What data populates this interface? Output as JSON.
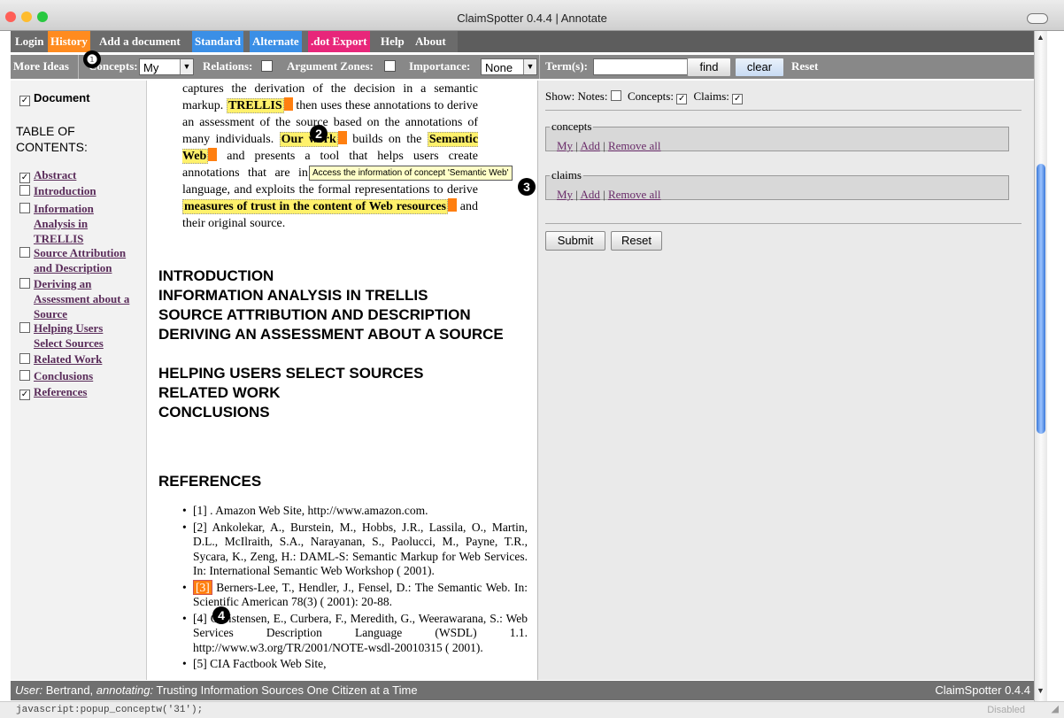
{
  "window": {
    "title": "ClaimSpotter 0.4.4 | Annotate",
    "lights": {
      "close": "#ff5f57",
      "minimize": "#febc2e",
      "zoom": "#28c840"
    }
  },
  "menu": [
    {
      "label": "Login",
      "bg": ""
    },
    {
      "label": "History",
      "bg": "#ff8b1f"
    },
    {
      "label": "Add a document",
      "bg": ""
    },
    {
      "label": "Standard",
      "bg": "#3b8fe6"
    },
    {
      "label": "Alternate",
      "bg": "#3b8fe6"
    },
    {
      "label": ".dot Export",
      "bg": "#e8267a"
    },
    {
      "label": "Help",
      "bg": ""
    },
    {
      "label": "About",
      "bg": ""
    }
  ],
  "toolbar": {
    "more_ideas": "More Ideas",
    "concepts_label": "Concepts:",
    "concepts_value": "My",
    "relations_label": "Relations:",
    "argument_zones_label": "Argument Zones:",
    "importance_label": "Importance:",
    "importance_value": "None",
    "terms_label": "Term(s):",
    "terms_value": "",
    "find_label": "find",
    "clear_label": "clear",
    "reset_label": "Reset"
  },
  "toc": {
    "document_label": "Document",
    "document_checked": true,
    "heading": "TABLE OF CONTENTS:",
    "items": [
      {
        "label": "Abstract",
        "checked": true
      },
      {
        "label": "Introduction",
        "checked": false
      },
      {
        "label": "Information Analysis in TRELLIS",
        "checked": false
      },
      {
        "label": "Source Attribution and Description",
        "checked": false
      },
      {
        "label": "Deriving an Assessment about a Source",
        "checked": false
      },
      {
        "label": "Helping Users Select Sources",
        "checked": false
      },
      {
        "label": "Related Work",
        "checked": false
      },
      {
        "label": "Conclusions",
        "checked": false
      },
      {
        "label": "References",
        "checked": true
      }
    ]
  },
  "abstract": {
    "p1": "captures the derivation of the decision in a semantic markup.",
    "hl_trellis": "TRELLIS",
    "p2": "then uses these annotations to derive an assessment of the source based on the annotations of many individuals.",
    "hl_our_work": "Our work",
    "p3": "builds on the",
    "hl_semantic_web": "Semantic Web",
    "p4": "and presents a tool that helps users create annotations that are in a mix of formal and human language, and exploits the formal representations to derive",
    "hl_measures": "measures of trust in the content of Web resources",
    "p5": "and their original source."
  },
  "sections": [
    "INTRODUCTION",
    "INFORMATION ANALYSIS IN TRELLIS",
    "SOURCE ATTRIBUTION AND DESCRIPTION",
    "DERIVING AN ASSESSMENT ABOUT A SOURCE",
    "HELPING USERS SELECT SOURCES",
    "RELATED WORK",
    "CONCLUSIONS"
  ],
  "references": {
    "heading": "REFERENCES",
    "r1": "[1] . Amazon Web Site, http://www.amazon.com.",
    "r2": "[2] Ankolekar, A., Burstein, M., Hobbs, J.R., Lassila, O., Martin, D.L., McIlraith, S.A., Narayanan, S., Paolucci, M., Payne, T.R., Sycara, K., Zeng, H.: DAML-S: Semantic Markup for Web Services. In: International Semantic Web Workshop ( 2001).",
    "r3_marker": "[3]",
    "r3_text": "Berners-Lee, T., Hendler, J., Fensel, D.: The Semantic Web. In: Scientific American 78(3) ( 2001): 20-88.",
    "r4": "[4] Christensen, E., Curbera, F., Meredith, G., Weerawarana, S.: Web Services Description Language (WSDL) 1.1. http://www.w3.org/TR/2001/NOTE-wsdl-20010315 ( 2001).",
    "r5": "[5] CIA Factbook Web Site,"
  },
  "right_panel": {
    "show_label": "Show:",
    "notes_label": "Notes:",
    "notes_checked": false,
    "concepts_label": "Concepts:",
    "concepts_checked": true,
    "claims_label": "Claims:",
    "claims_checked": true,
    "concepts_box": {
      "legend": "concepts",
      "my": "My",
      "add": "Add",
      "remove": "Remove all"
    },
    "claims_box": {
      "legend": "claims",
      "my": "My",
      "add": "Add",
      "remove": "Remove all"
    },
    "submit_label": "Submit",
    "reset_label": "Reset"
  },
  "tooltip": "Access the information of concept 'Semantic Web'",
  "callouts": [
    "❶",
    "2",
    "3",
    "4"
  ],
  "status": {
    "user_prefix": "User:",
    "user": "Bertrand,",
    "annotating_prefix": "annotating:",
    "document": "Trusting Information Sources One Citizen at a Time",
    "app": "ClaimSpotter 0.4.4"
  },
  "js_status": "javascript:popup_conceptw('31');",
  "disabled_label": "Disabled"
}
